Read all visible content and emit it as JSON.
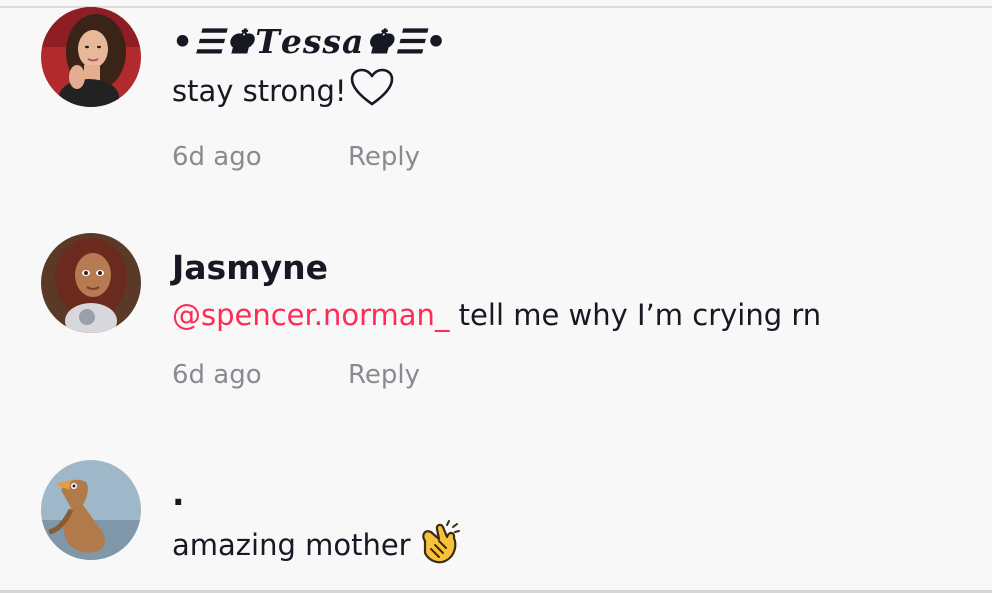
{
  "comments": [
    {
      "username": "•☰♚𝑻𝒆𝒔𝒔𝒂♚☰•",
      "text": "stay strong!",
      "text_icon": "heart-outline-icon",
      "time": "6d ago",
      "reply_label": "Reply"
    },
    {
      "username": "Jasmyne",
      "mention": "@spencer.norman_",
      "text": " tell me why I’m crying rn",
      "time": "6d ago",
      "reply_label": "Reply"
    },
    {
      "username": ".",
      "text": "amazing mother",
      "text_icon": "clapping-hands-icon"
    }
  ],
  "colors": {
    "background": "#f8f8f8",
    "text": "#161823",
    "mention": "#fe2c55",
    "meta": "#8a8b91"
  }
}
